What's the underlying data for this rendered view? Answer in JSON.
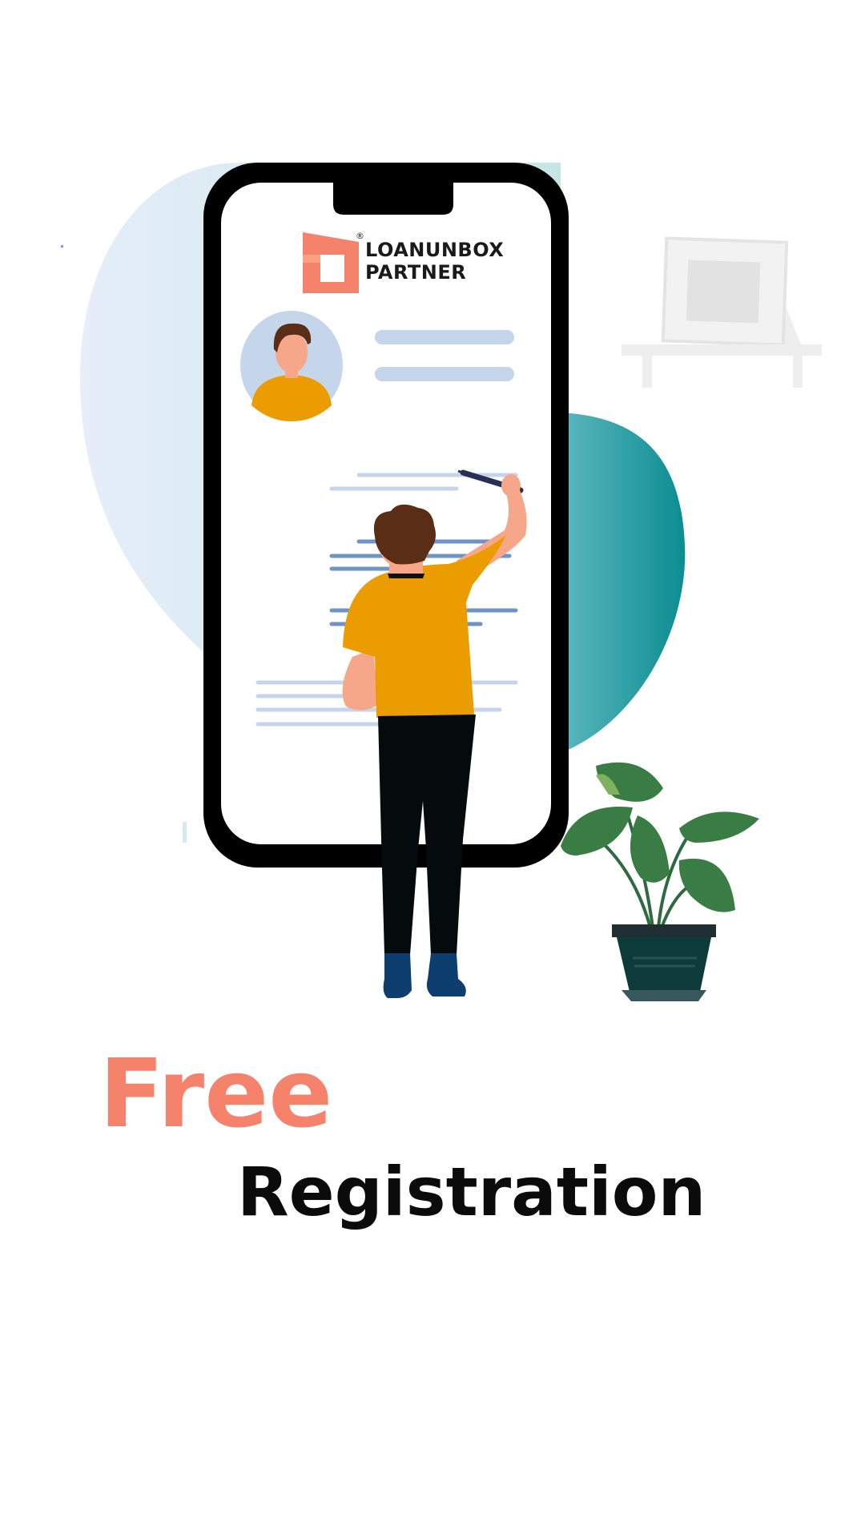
{
  "logo": {
    "line1": "LOANUNBOX",
    "line2": "PARTNER",
    "registered_mark": "®",
    "icon": "loanunbox-logo-icon"
  },
  "headline": {
    "accent": "Free",
    "main": "Registration"
  },
  "colors": {
    "accent": "#f5826b",
    "teal": "#11908f",
    "shirt": "#eb9d00",
    "form_line": "#c5d5ea",
    "text": "#0b0b0b"
  }
}
